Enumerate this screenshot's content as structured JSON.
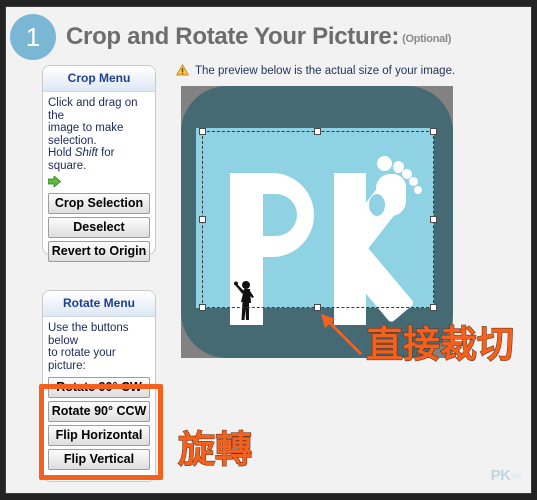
{
  "header": {
    "step_number": "1",
    "title": "Crop and Rotate Your Picture:",
    "optional": "(Optional)"
  },
  "crop_panel": {
    "title": "Crop Menu",
    "instruction_line1": "Click and drag on the",
    "instruction_line2": "image to make",
    "instruction_line3": "selection.",
    "instruction_line4_pre": "Hold ",
    "instruction_line4_em": "Shift",
    "instruction_line4_post": " for square.",
    "buttons": [
      {
        "label": "Crop Selection"
      },
      {
        "label": "Deselect"
      },
      {
        "label": "Revert to Origin"
      }
    ]
  },
  "rotate_panel": {
    "title": "Rotate Menu",
    "instruction_line1": "Use the buttons",
    "instruction_line2": "below",
    "instruction_line3": "to rotate your picture:",
    "buttons": [
      {
        "label": "Rotate 90° CW"
      },
      {
        "label": "Rotate 90° CCW"
      },
      {
        "label": "Flip Horizontal"
      },
      {
        "label": "Flip Vertical"
      }
    ]
  },
  "preview": {
    "note": "The preview below is the actual size of your image.",
    "logo_text": "PK",
    "background_color": "#828282",
    "tile_color": "#466a73",
    "inner_color": "#8ed2e4"
  },
  "annotations": {
    "crop_label": "直接裁切",
    "rotate_label": "旋轉",
    "highlight_color": "#f4611f"
  },
  "watermark": {
    "text": "PK",
    "sub": "▒▒▒"
  }
}
